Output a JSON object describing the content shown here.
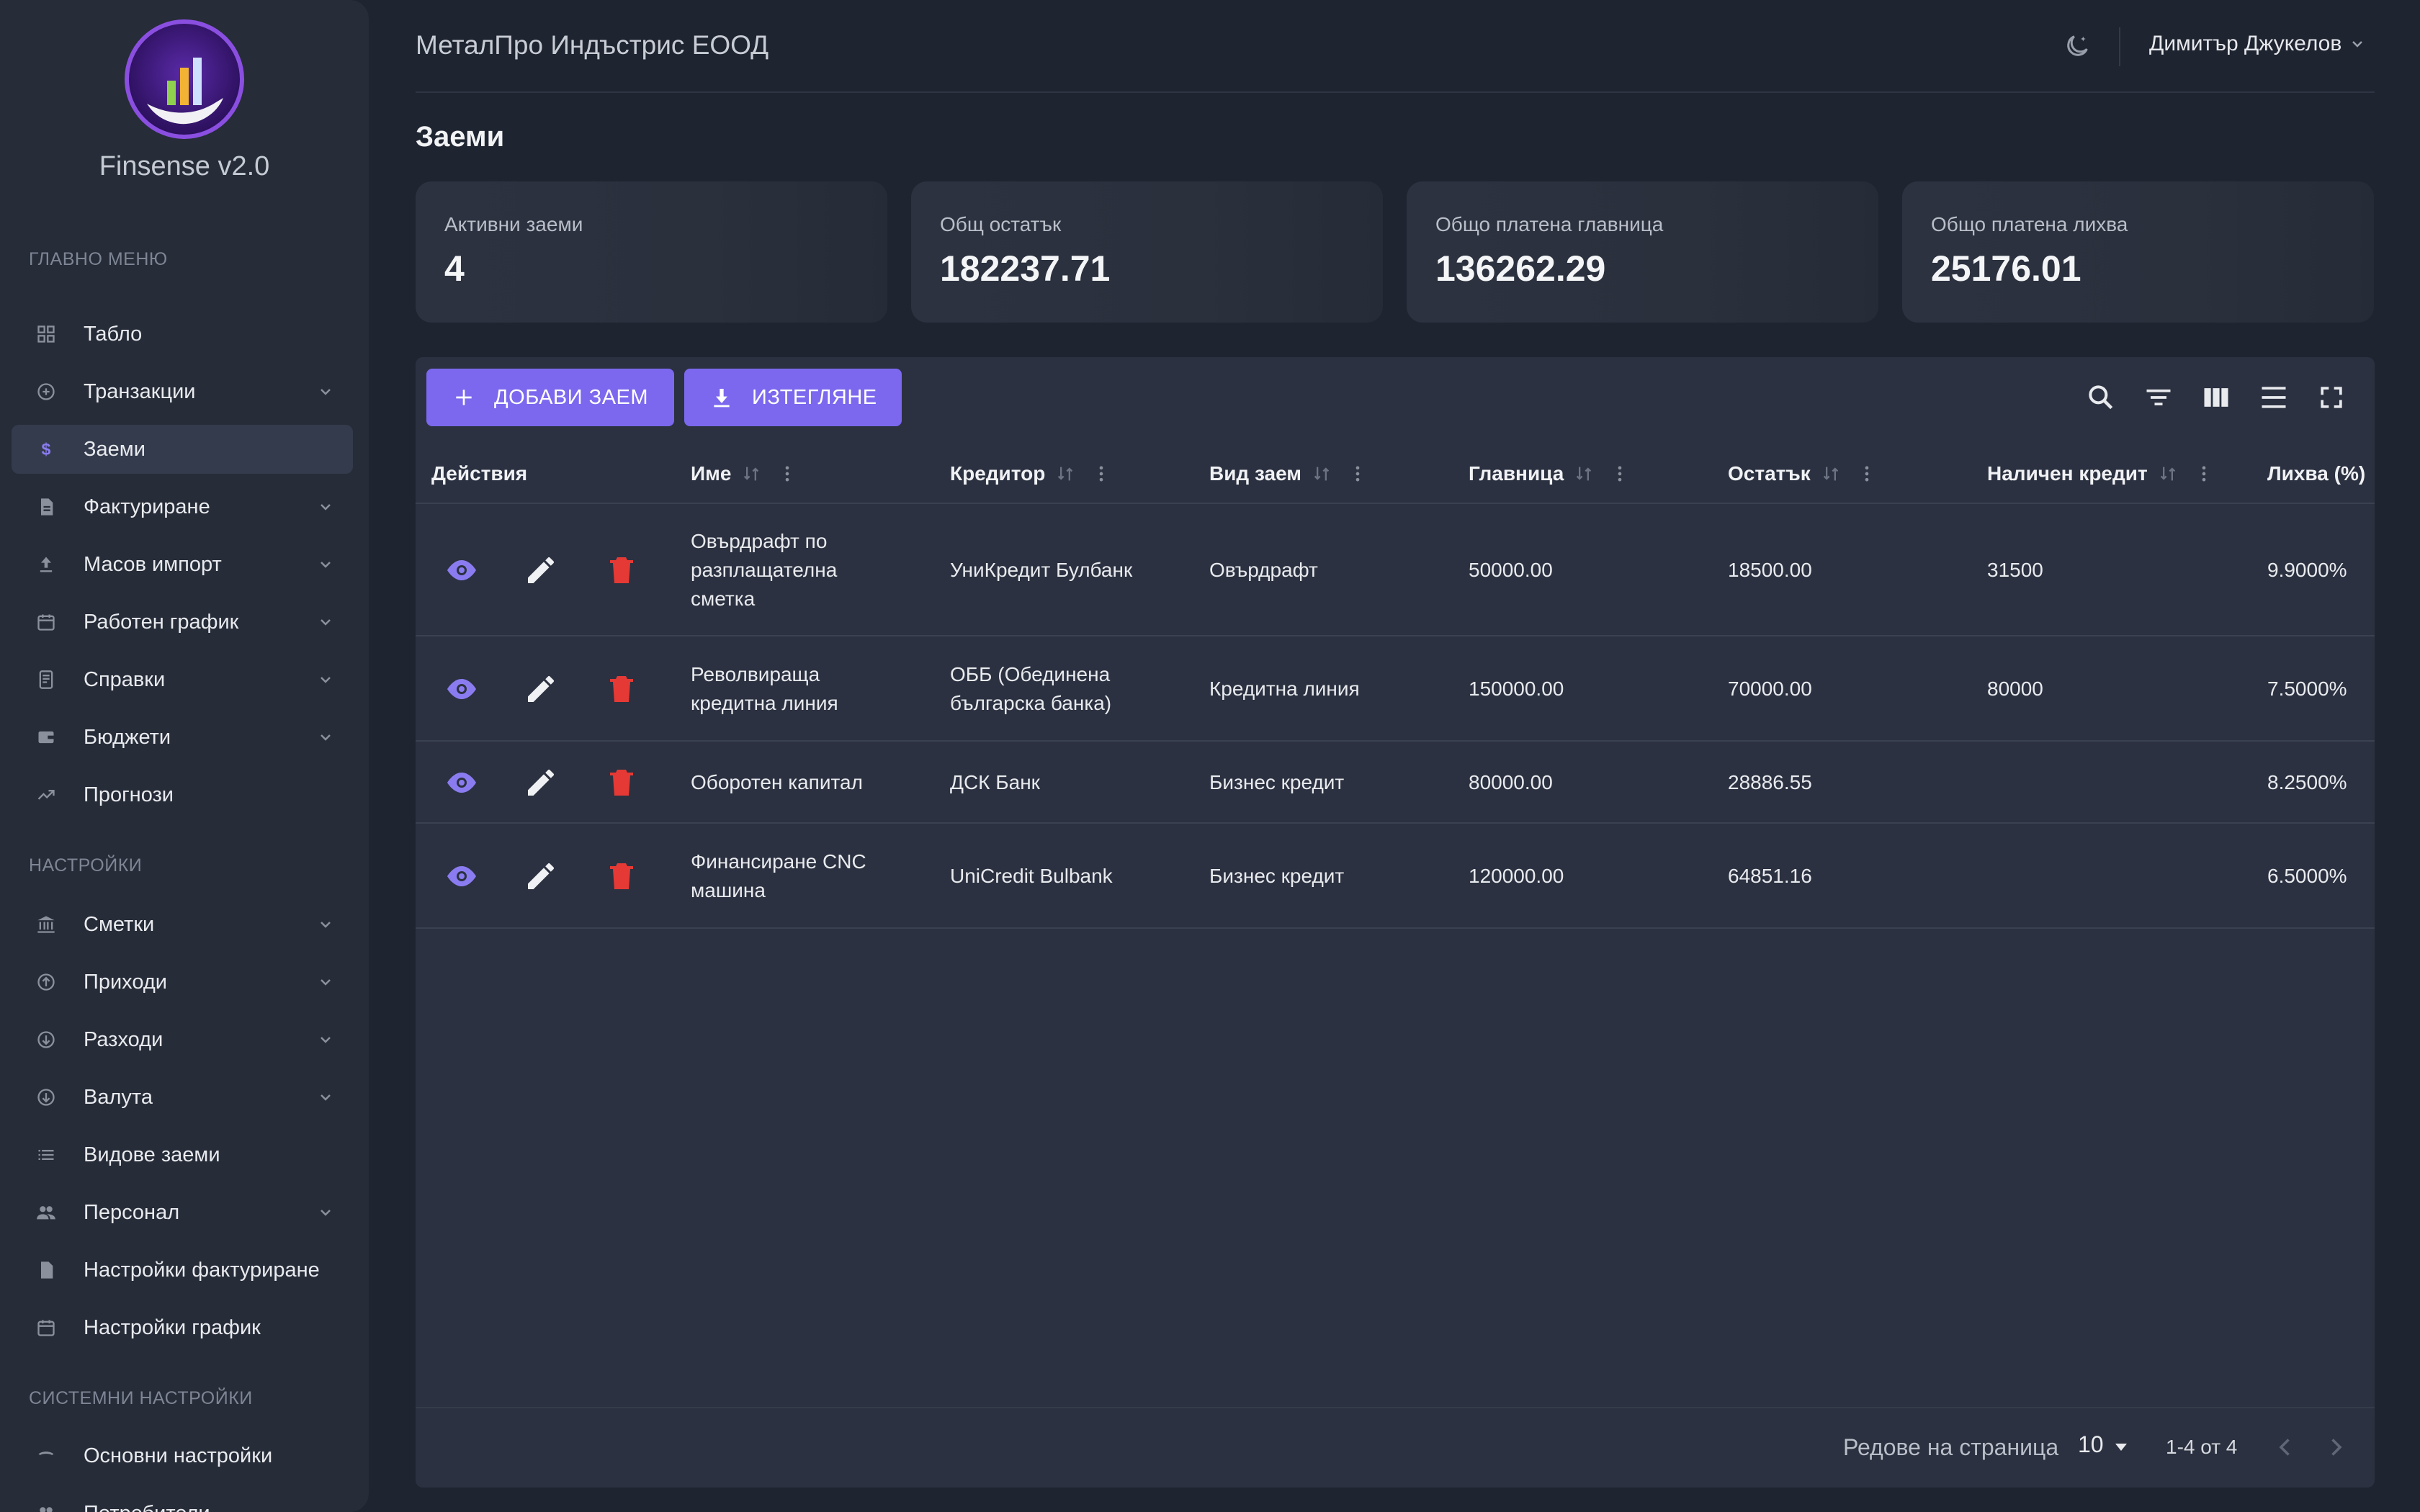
{
  "sidebar": {
    "brand": "Finsense v2.0",
    "sections": {
      "main": "ГЛАВНО МЕНЮ",
      "settings": "НАСТРОЙКИ",
      "system": "СИСТЕМНИ НАСТРОЙКИ"
    },
    "items": [
      {
        "label": "Табло",
        "icon": "dashboard-icon",
        "expandable": false,
        "active": false
      },
      {
        "label": "Транзакции",
        "icon": "transactions-icon",
        "expandable": true,
        "active": false
      },
      {
        "label": "Заеми",
        "icon": "dollar-icon",
        "expandable": false,
        "active": true
      },
      {
        "label": "Фактуриране",
        "icon": "invoice-icon",
        "expandable": true,
        "active": false
      },
      {
        "label": "Масов импорт",
        "icon": "upload-icon",
        "expandable": true,
        "active": false
      },
      {
        "label": "Работен график",
        "icon": "calendar-icon",
        "expandable": true,
        "active": false
      },
      {
        "label": "Справки",
        "icon": "receipt-icon",
        "expandable": true,
        "active": false
      },
      {
        "label": "Бюджети",
        "icon": "wallet-icon",
        "expandable": true,
        "active": false
      },
      {
        "label": "Прогнози",
        "icon": "trending-icon",
        "expandable": false,
        "active": false
      }
    ],
    "settings_items": [
      {
        "label": "Сметки",
        "icon": "bank-icon",
        "expandable": true
      },
      {
        "label": "Приходи",
        "icon": "income-icon",
        "expandable": true
      },
      {
        "label": "Разходи",
        "icon": "expense-icon",
        "expandable": true
      },
      {
        "label": "Валута",
        "icon": "currency-icon",
        "expandable": true
      },
      {
        "label": "Видове заеми",
        "icon": "list-icon",
        "expandable": false
      },
      {
        "label": "Персонал",
        "icon": "people-icon",
        "expandable": true
      },
      {
        "label": "Настройки фактуриране",
        "icon": "document-icon",
        "expandable": false
      },
      {
        "label": "Настройки график",
        "icon": "calendar-icon",
        "expandable": false
      }
    ],
    "system_items": [
      {
        "label": "Основни настройки",
        "icon": "settings-icon",
        "expandable": false
      },
      {
        "label": "Потребители",
        "icon": "users-icon",
        "expandable": false
      }
    ]
  },
  "header": {
    "company": "МеталПро Индъстрис ЕООД",
    "user": "Димитър Джукелов"
  },
  "page": {
    "title": "Заеми"
  },
  "stats": [
    {
      "label": "Активни заеми",
      "value": "4"
    },
    {
      "label": "Общ остатък",
      "value": "182237.71"
    },
    {
      "label": "Общо платена главница",
      "value": "136262.29"
    },
    {
      "label": "Общо платена лихва",
      "value": "25176.01"
    }
  ],
  "toolbar": {
    "add_label": "ДОБАВИ ЗАЕМ",
    "download_label": "ИЗТЕГЛЯНЕ"
  },
  "table": {
    "columns": [
      "Действия",
      "Име",
      "Кредитор",
      "Вид заем",
      "Главница",
      "Остатък",
      "Наличен кредит",
      "Лихва (%)"
    ],
    "rows": [
      {
        "name": [
          "Овърдрафт по",
          "разплащателна",
          "сметка"
        ],
        "creditor": [
          "УниКредит Булбанк"
        ],
        "type": "Овърдрафт",
        "principal": "50000.00",
        "balance": "18500.00",
        "available": "31500",
        "rate": "9.9000%"
      },
      {
        "name": [
          "Револвираща",
          "кредитна линия"
        ],
        "creditor": [
          "ОББ (Обединена",
          "българска банка)"
        ],
        "type": "Кредитна линия",
        "principal": "150000.00",
        "balance": "70000.00",
        "available": "80000",
        "rate": "7.5000%"
      },
      {
        "name": [
          "Оборотен капитал"
        ],
        "creditor": [
          "ДСК Банк"
        ],
        "type": "Бизнес кредит",
        "principal": "80000.00",
        "balance": "28886.55",
        "available": "",
        "rate": "8.2500%"
      },
      {
        "name": [
          "Финансиране CNC",
          "машина"
        ],
        "creditor": [
          "UniCredit Bulbank"
        ],
        "type": "Бизнес кредит",
        "principal": "120000.00",
        "balance": "64851.16",
        "available": "",
        "rate": "6.5000%"
      }
    ]
  },
  "pagination": {
    "rows_per_page_label": "Редове на страница",
    "rows_per_page": "10",
    "range": "1-4 от 4"
  },
  "colors": {
    "accent": "#7b68ee",
    "delete": "#e53935",
    "background": "#1e2430",
    "sidebar": "#262c38",
    "panel": "#2b3140"
  }
}
